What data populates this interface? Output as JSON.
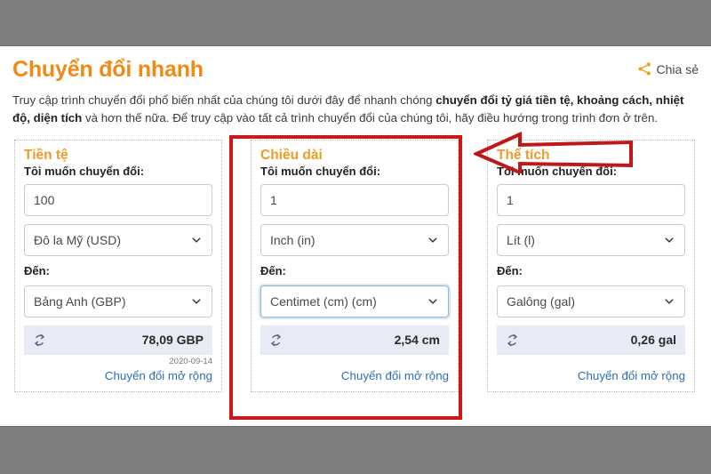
{
  "header": {
    "title": "Chuyển đổi nhanh",
    "share_label": "Chia sẻ",
    "share_icon": "share-nodes-icon"
  },
  "intro": {
    "part1": "Truy cập trình chuyển đổi phổ biến nhất của chúng tôi dưới đây để nhanh chóng ",
    "bold1": "chuyển đổi tỷ giá tiền tệ, khoảng cách, nhiệt độ, diện tích",
    "part2": " và hơn thế nữa. Để truy cập vào tất cả trình chuyển đổi của chúng tôi, hãy điều hướng trong trình đơn ở trên."
  },
  "labels": {
    "from_label": "Tôi muốn chuyển đổi:",
    "to_label": "Đến:",
    "more_link": "Chuyển đổi mở rộng",
    "swap_icon": "swap-arrows-icon",
    "chevron_icon": "chevron-down-icon"
  },
  "cards": [
    {
      "title": "Tiền tệ",
      "amount": "100",
      "from_unit": "Đô la Mỹ (USD)",
      "to_unit": "Bảng Anh (GBP)",
      "result": "78,09 GBP",
      "date": "2020-09-14",
      "focused": false
    },
    {
      "title": "Chiều dài",
      "amount": "1",
      "from_unit": "Inch (in)",
      "to_unit": "Centimet (cm) (cm)",
      "result": "2,54 cm",
      "date": "",
      "focused": true
    },
    {
      "title": "Thể tích",
      "amount": "1",
      "from_unit": "Lít (l)",
      "to_unit": "Galông (gal)",
      "result": "0,26 gal",
      "date": "",
      "focused": false
    }
  ],
  "annotations": {
    "highlight_color": "#d01616",
    "arrow_color": "#d01616",
    "highlight_target": "Chiều dài",
    "arrow_target": "Thể tích"
  },
  "colors": {
    "brand_orange": "#ef8a17",
    "card_title_orange": "#ef9b24",
    "link_blue": "#2d6fb1",
    "result_bg": "#e8ebf6",
    "chrome_gray": "#7e7e7e"
  }
}
